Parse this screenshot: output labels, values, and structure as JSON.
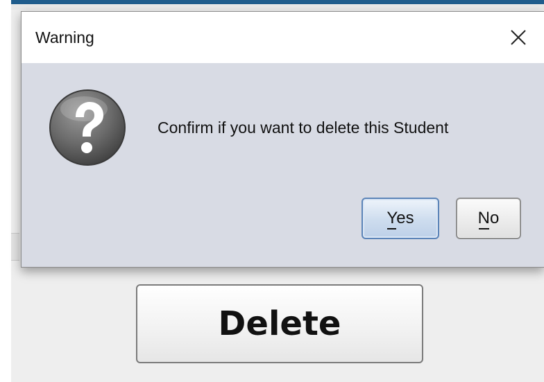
{
  "dialog": {
    "title": "Warning",
    "close_glyph": "×",
    "icon": "question-icon",
    "message": "Confirm if you want to delete this Student",
    "yes_label": "Yes",
    "no_label": "No"
  },
  "background": {
    "delete_label": "Delete"
  },
  "colors": {
    "dialog_body": "#d8dbe4",
    "default_button_border": "#5b84b8",
    "icon_gray": "#6d6d6d"
  }
}
